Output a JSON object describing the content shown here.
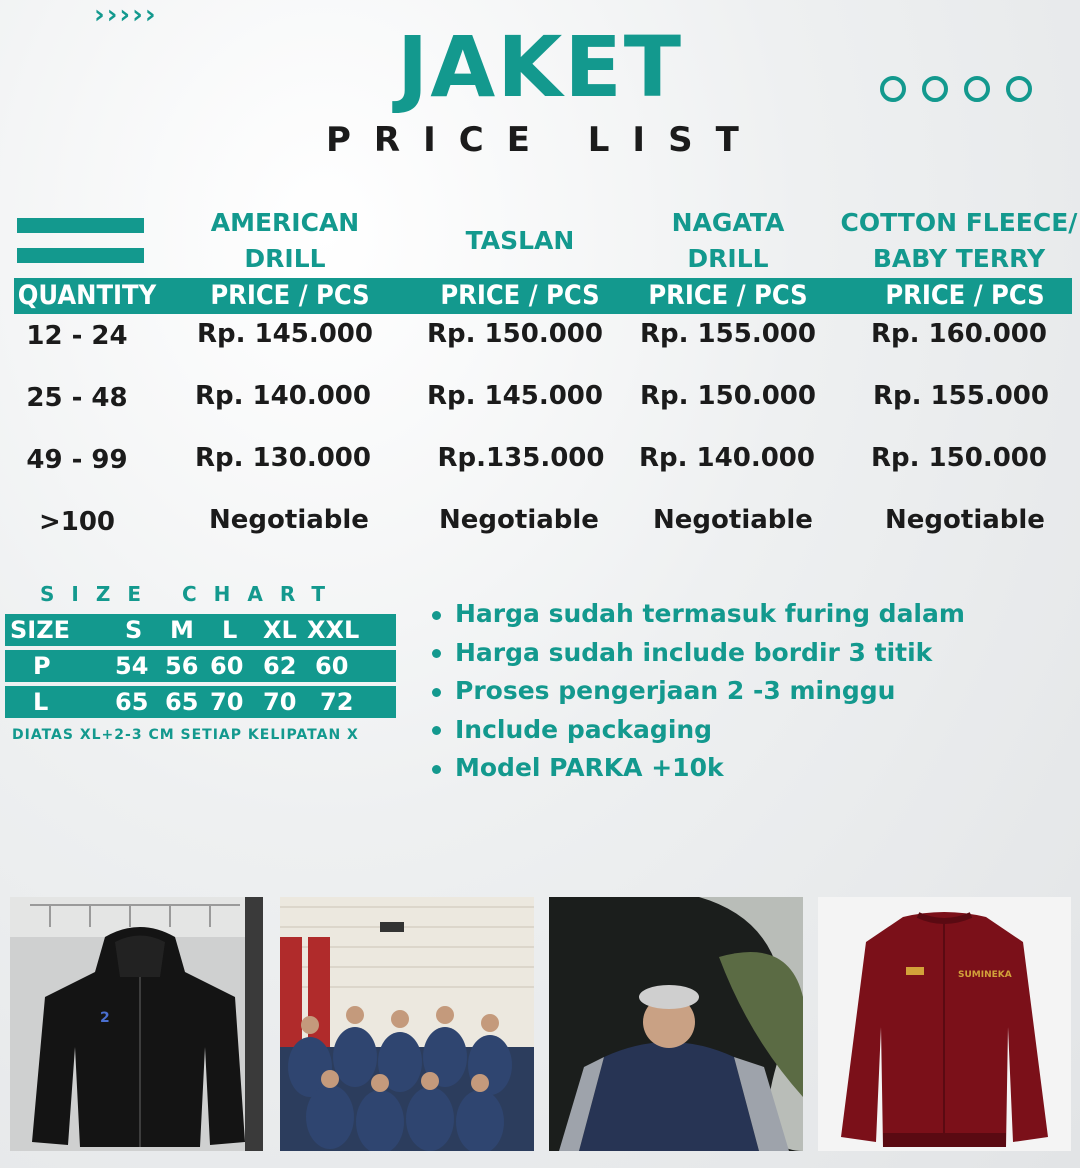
{
  "header": {
    "chevrons": "›››››",
    "title": "JAKET",
    "subtitle": "PRICE LIST"
  },
  "table": {
    "columns": [
      {
        "line1": "AMERICAN",
        "line2": "DRILL"
      },
      {
        "line1": "TASLAN",
        "line2": ""
      },
      {
        "line1": "NAGATA",
        "line2": "DRILL"
      },
      {
        "line1": "COTTON FLEECE/",
        "line2": "BABY TERRY"
      }
    ],
    "quantity_header": "QUANTITY",
    "price_header": "PRICE / PCS",
    "rows": [
      {
        "qty": "12 - 24",
        "prices": [
          "Rp. 145.000",
          "Rp. 150.000",
          "Rp. 155.000",
          "Rp. 160.000"
        ]
      },
      {
        "qty": "25 - 48",
        "prices": [
          "Rp. 140.000",
          "Rp. 145.000",
          "Rp. 150.000",
          "Rp. 155.000"
        ]
      },
      {
        "qty": "49 - 99",
        "prices": [
          "Rp. 130.000",
          "Rp.135.000",
          "Rp. 140.000",
          "Rp. 150.000"
        ]
      },
      {
        "qty": ">100",
        "prices": [
          "Negotiable",
          "Negotiable",
          "Negotiable",
          "Negotiable"
        ]
      }
    ]
  },
  "size_chart": {
    "title": "SIZE CHART",
    "header": [
      "SIZE",
      "S",
      "M",
      "L",
      "XL",
      "XXL"
    ],
    "rows": [
      [
        "P",
        "54",
        "56",
        "60",
        "62",
        "60"
      ],
      [
        "L",
        "65",
        "65",
        "70",
        "70",
        "72"
      ]
    ],
    "note": "DIATAS XL+2-3 CM SETIAP KELIPATAN X"
  },
  "notes": [
    "Harga sudah termasuk furing dalam",
    "Harga sudah include bordir 3 titik",
    "Proses pengerjaan 2 -3 minggu",
    "Include packaging",
    "Model PARKA +10k"
  ],
  "photos": [
    {
      "icon": "black-hooded-jacket-photo"
    },
    {
      "icon": "group-in-navy-jackets-photo"
    },
    {
      "icon": "person-in-navy-jacket-photo"
    },
    {
      "icon": "maroon-bomber-jacket-photo",
      "badge": "SUMINEKA"
    }
  ]
}
